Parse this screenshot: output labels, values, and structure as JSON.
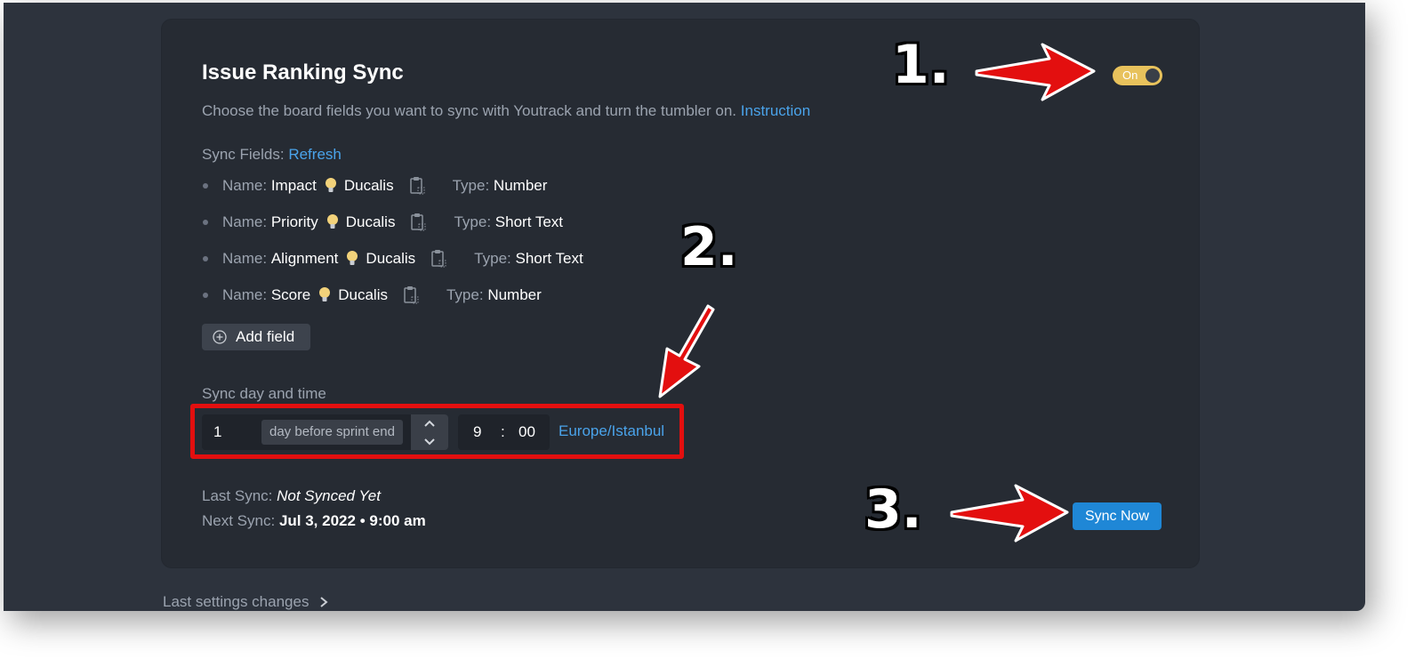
{
  "card": {
    "title": "Issue Ranking Sync",
    "description": "Choose the board fields you want to sync with Youtrack and turn the tumbler on.",
    "instruction_link": "Instruction",
    "toggle_label": "On"
  },
  "sync_fields": {
    "label": "Sync Fields:",
    "refresh_link": "Refresh",
    "name_label": "Name:",
    "type_label": "Type:",
    "items": [
      {
        "name": "Impact",
        "source": "Ducalis",
        "type": "Number"
      },
      {
        "name": "Priority",
        "source": "Ducalis",
        "type": "Short Text"
      },
      {
        "name": "Alignment",
        "source": "Ducalis",
        "type": "Short Text"
      },
      {
        "name": "Score",
        "source": "Ducalis",
        "type": "Number"
      }
    ],
    "add_field_label": "Add field"
  },
  "schedule": {
    "label": "Sync day and time",
    "days_value": "1",
    "days_suffix": "day before sprint end",
    "hour": "9",
    "separator": ":",
    "minute": "00",
    "timezone": "Europe/Istanbul"
  },
  "status": {
    "last_sync_label": "Last Sync:",
    "last_sync_value": "Not Synced Yet",
    "next_sync_label": "Next Sync:",
    "next_sync_date": "Jul 3, 2022",
    "next_sync_dot": "•",
    "next_sync_time": "9:00 am",
    "sync_now_label": "Sync Now"
  },
  "footer": {
    "last_settings_label": "Last settings changes"
  },
  "annotations": {
    "marker_1": "1.",
    "marker_2": "2.",
    "marker_3": "3."
  },
  "colors": {
    "window_bg": "#2d333d",
    "card_bg": "#262b33",
    "link": "#4aa3ea",
    "toggle_on": "#e8c25c",
    "primary_button": "#1f87d6",
    "annotation_red": "#e30f0f"
  },
  "icons": {
    "bulb": "lightbulb-icon",
    "clipboard": "clipboard-icon",
    "add": "plus-circle-icon",
    "up": "chevron-up-icon",
    "down": "chevron-down-icon",
    "next": "chevron-right-icon"
  }
}
